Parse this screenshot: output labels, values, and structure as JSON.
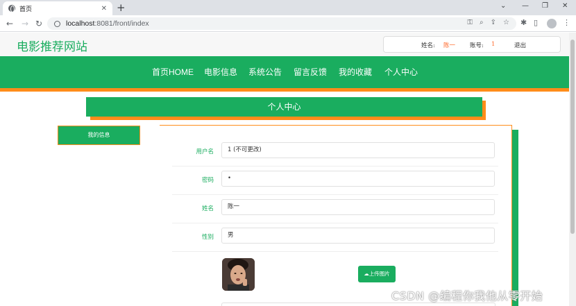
{
  "browser": {
    "tab_title": "首页",
    "tab_close": "✕",
    "new_tab": "+",
    "url_host": "localhost",
    "url_path": ":8081/front/index",
    "win_controls": [
      "⌄",
      "—",
      "❐",
      "✕"
    ]
  },
  "site": {
    "title": "电影推荐网站"
  },
  "user": {
    "name_label": "姓名:",
    "name_value": "陈一",
    "account_label": "账号:",
    "account_value": "1",
    "logout": "退出"
  },
  "nav": [
    "首页HOME",
    "电影信息",
    "系统公告",
    "留言反馈",
    "我的收藏",
    "个人中心"
  ],
  "section": {
    "banner": "个人中心",
    "side_tab": "我的信息"
  },
  "form": {
    "fields": [
      {
        "label": "用户名",
        "value": "1 (不可更改)"
      },
      {
        "label": "密码",
        "value": "•"
      },
      {
        "label": "姓名",
        "value": "陈一"
      },
      {
        "label": "性别",
        "value": "男"
      }
    ],
    "upload_button": "上传图片"
  },
  "watermark": "CSDN @编程你我他从零开始",
  "colors": {
    "primary": "#1aad5f",
    "accent": "#ff8c1a",
    "highlight": "#ff6a2c"
  }
}
